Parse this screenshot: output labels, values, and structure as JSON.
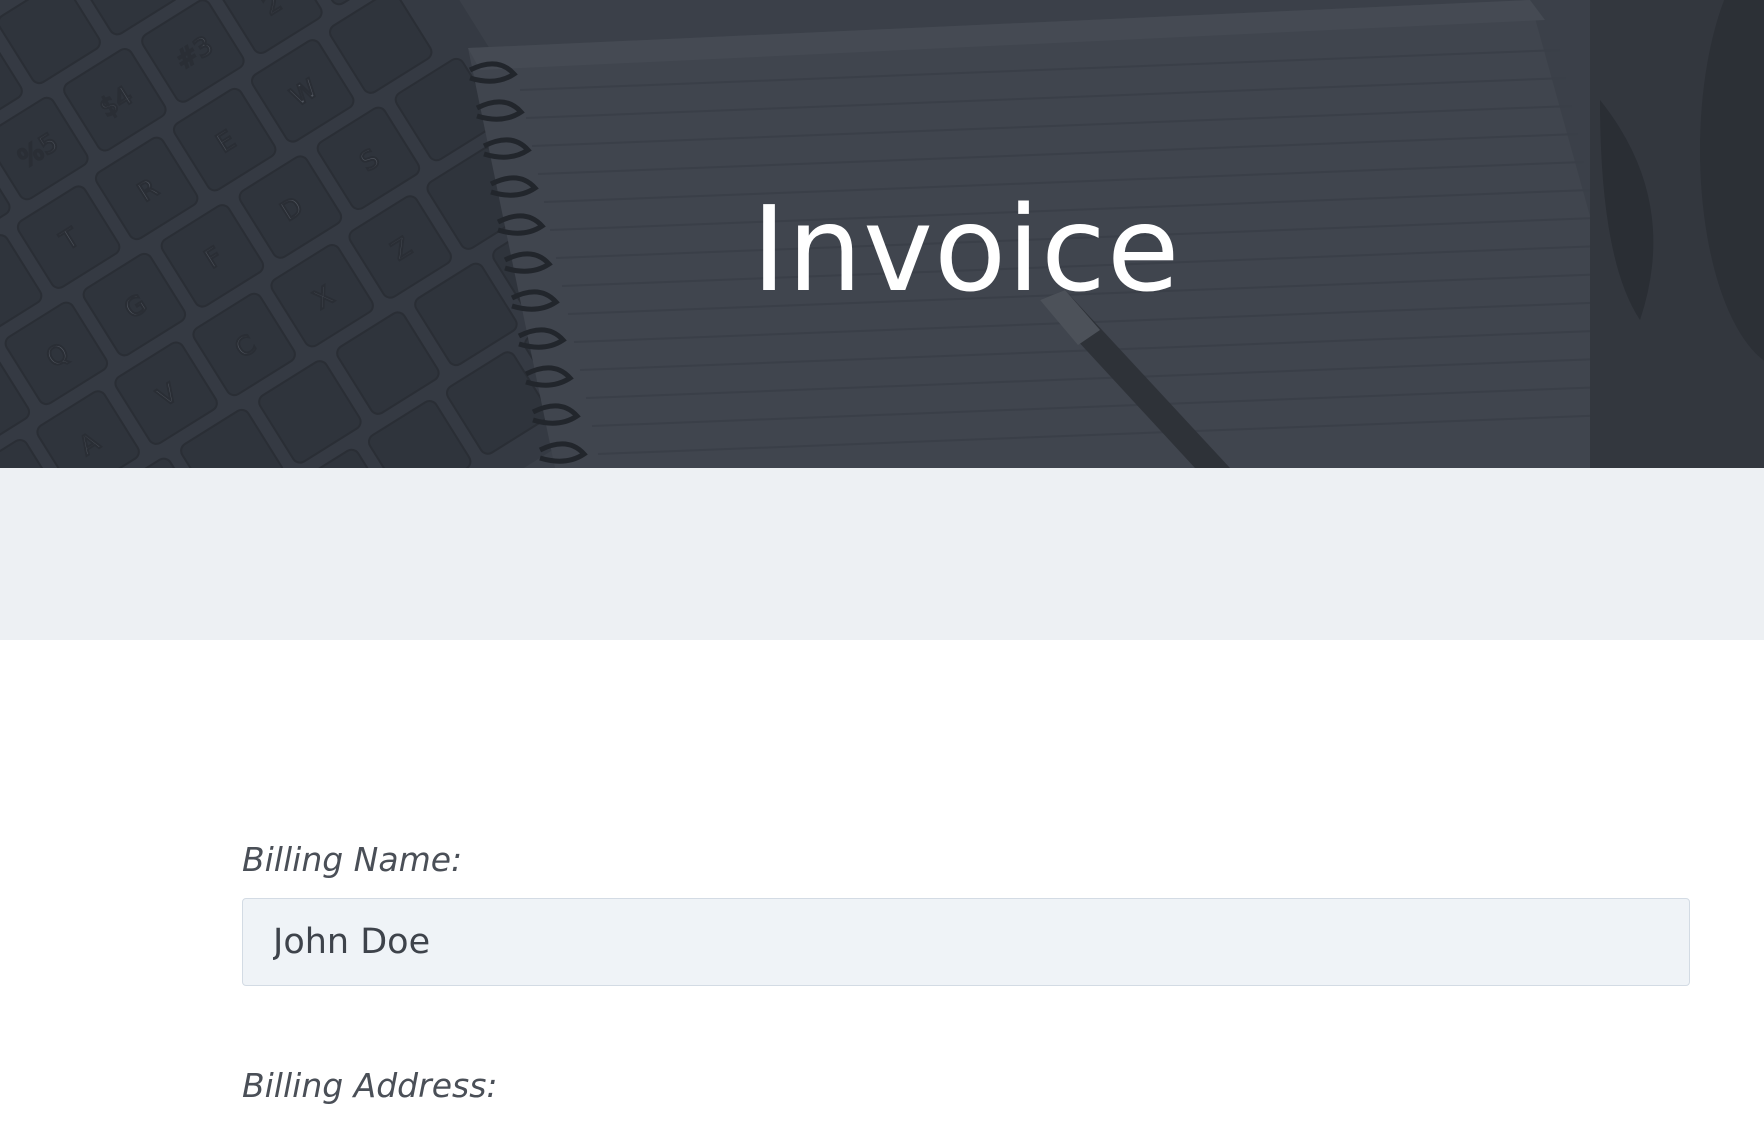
{
  "header": {
    "title": "Invoice",
    "background_color": "#3b4049",
    "title_color": "#ffffff"
  },
  "band": {
    "color": "#edf0f3"
  },
  "form": {
    "billing_name": {
      "label": "Billing Name:",
      "value": "John Doe"
    },
    "billing_address": {
      "label": "Billing Address:"
    }
  },
  "keyboard_keys": [
    "6",
    "%5",
    "$4",
    "#3",
    "2",
    "Y",
    "T",
    "R",
    "E",
    "W",
    "Q",
    "G",
    "F",
    "D",
    "S",
    "A",
    "V",
    "C",
    "X",
    "Z"
  ]
}
